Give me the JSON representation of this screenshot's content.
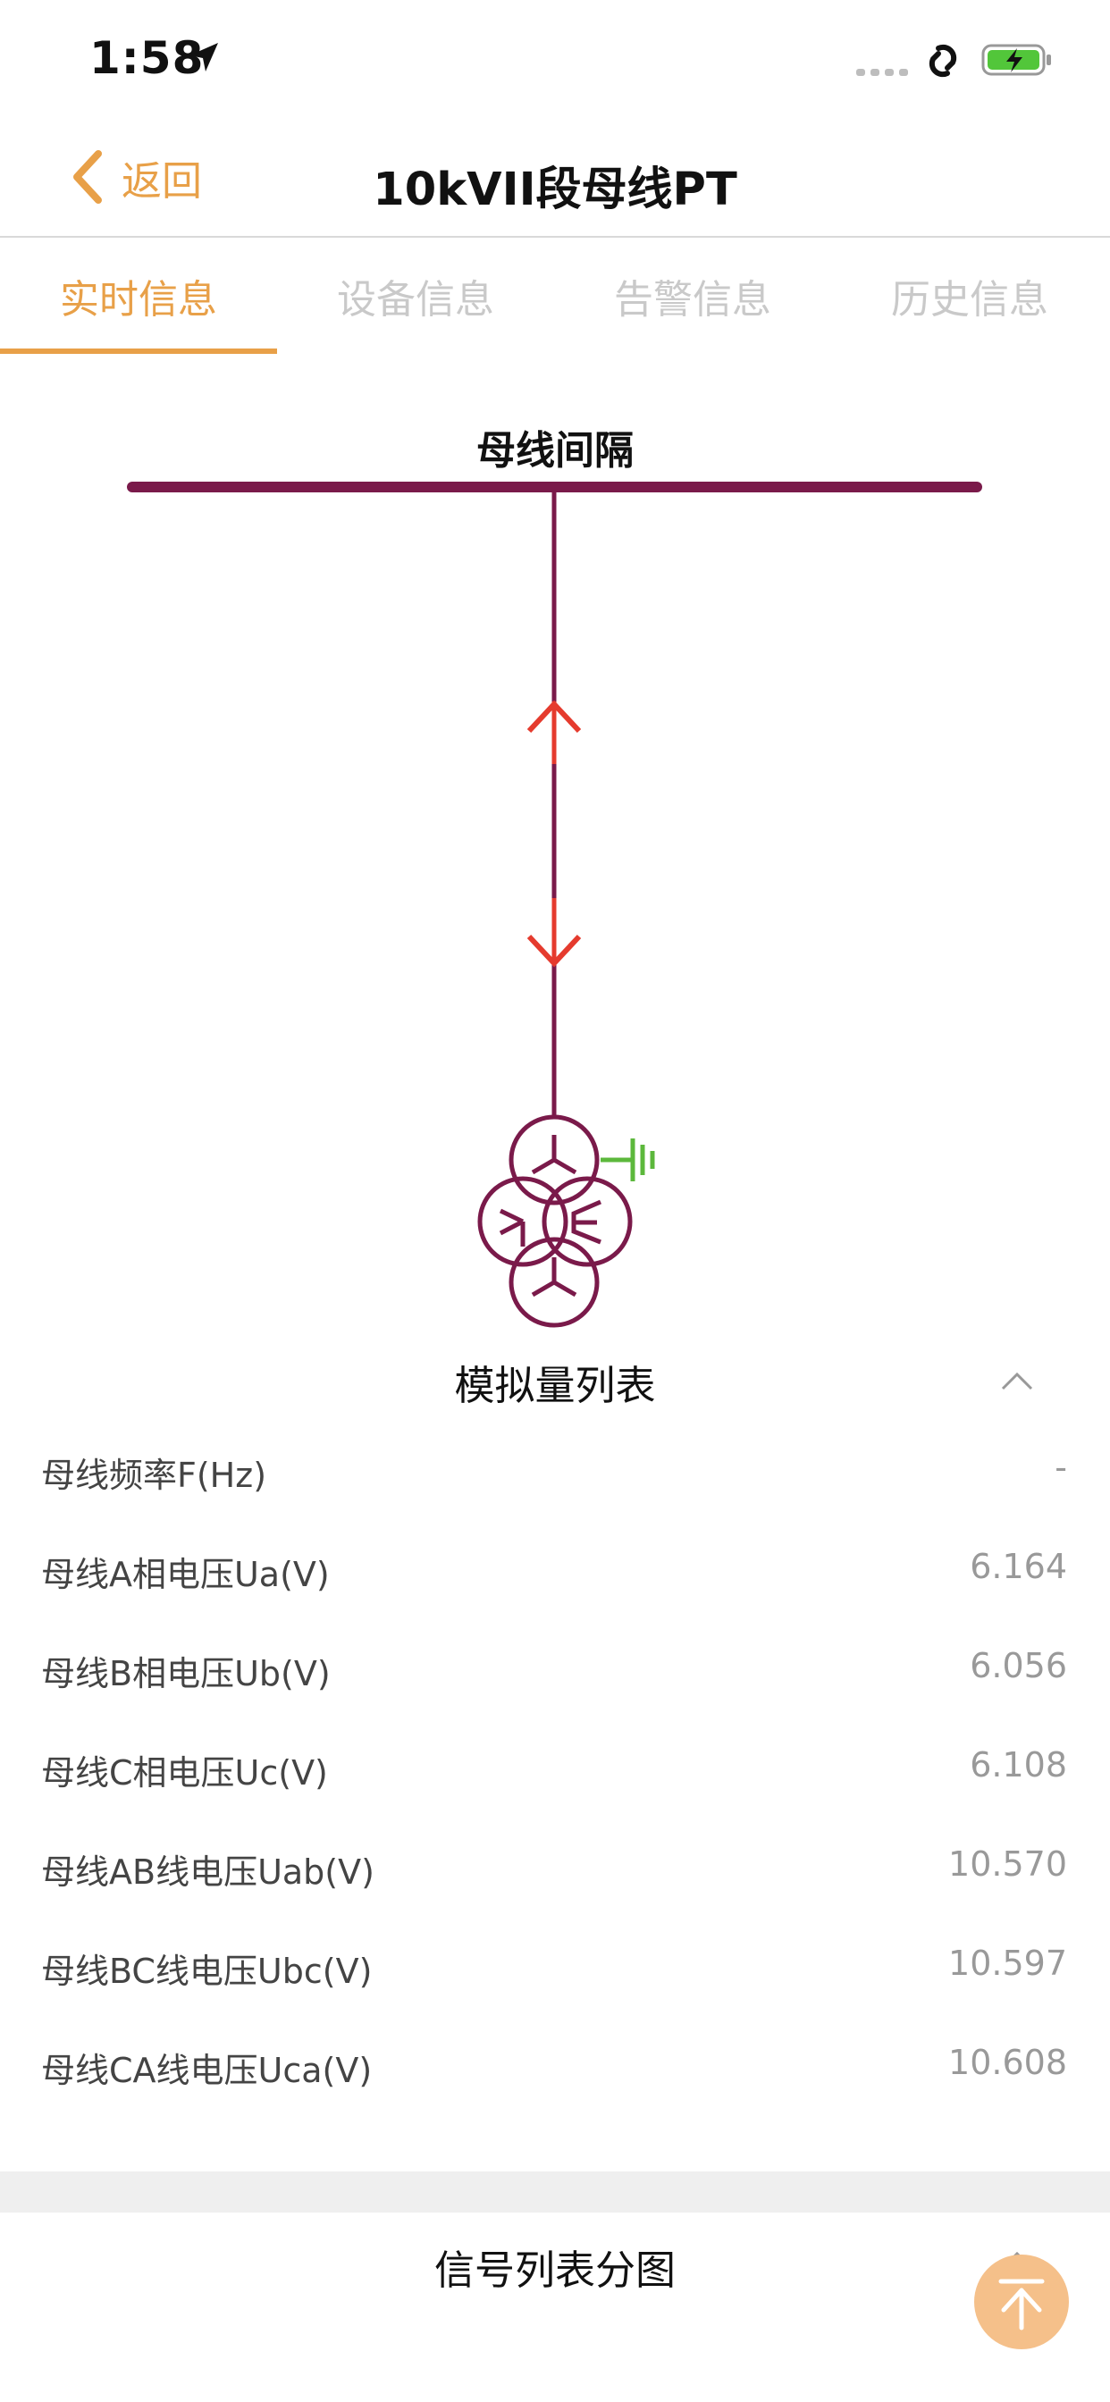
{
  "status_bar": {
    "time": "1:58"
  },
  "nav": {
    "back_label": "返回",
    "title": "10kVII段母线PT"
  },
  "tabs": [
    {
      "label": "实时信息",
      "active": true
    },
    {
      "label": "设备信息",
      "active": false
    },
    {
      "label": "告警信息",
      "active": false
    },
    {
      "label": "历史信息",
      "active": false
    }
  ],
  "diagram": {
    "title": "母线间隔"
  },
  "analog": {
    "title": "模拟量列表",
    "rows": [
      {
        "label": "母线频率F(Hz)",
        "value": "-"
      },
      {
        "label": "母线A相电压Ua(V)",
        "value": "6.164"
      },
      {
        "label": "母线B相电压Ub(V)",
        "value": "6.056"
      },
      {
        "label": "母线C相电压Uc(V)",
        "value": "6.108"
      },
      {
        "label": "母线AB线电压Uab(V)",
        "value": "10.570"
      },
      {
        "label": "母线BC线电压Ubc(V)",
        "value": "10.597"
      },
      {
        "label": "母线CA线电压Uca(V)",
        "value": "10.608"
      }
    ]
  },
  "signal": {
    "title": "信号列表分图"
  },
  "icons": {
    "back": "chevron-left-icon",
    "collapse": "chevron-up-icon",
    "fab": "arrow-to-top-icon",
    "battery": "battery-charging-icon",
    "location": "location-arrow-icon"
  },
  "colors": {
    "accent": "#e8a048",
    "bus_line": "#7a1a4a",
    "arrow_red": "#e53b2e",
    "ground_green": "#5cb83c",
    "fab_bg": "#f5c08a"
  }
}
